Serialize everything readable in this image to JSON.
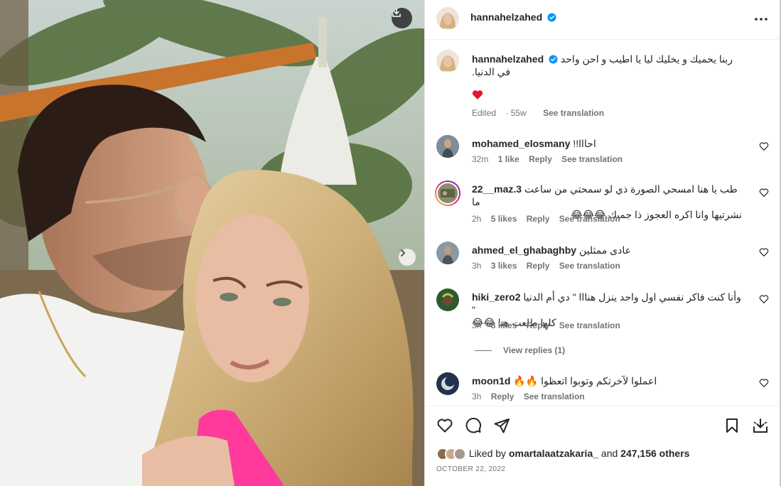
{
  "post": {
    "author": "hannahelzahed",
    "caption": "ربنا يحميك و يخليك ليا يا اطيب و احن واحد في الدنيا.",
    "caption_emoji": "❤️",
    "edited_label": "Edited",
    "age": "55w",
    "see_translation": "See translation"
  },
  "comments": [
    {
      "user": "mohamed_elosmany",
      "text": "احااا!!",
      "time": "32m",
      "likes": "1 like",
      "reply": "Reply",
      "translate": "See translation",
      "avatar_color": "#6d7f8e"
    },
    {
      "user": "22__maz.3",
      "text_line1": "طب يا هنا امسحي الصورة ذي لو سمحتي من ساعت ما",
      "text_line2": "نشرتيها وانا اكره العجوز ذا جمبك 😂😂😂",
      "time": "2h",
      "likes": "5 likes",
      "reply": "Reply",
      "translate": "See translation",
      "avatar_color": "#8a8f6a"
    },
    {
      "user": "ahmed_el_ghabaghby",
      "text": "عادى ممثلين",
      "time": "3h",
      "likes": "3 likes",
      "reply": "Reply",
      "translate": "See translation",
      "avatar_color": "#7a8a94"
    },
    {
      "user": "hiki_zero2",
      "text_line1": "وأنا كنت فاكر نفسي اول واحد ينزل هنااا \" دي أم الدنيا \"",
      "text_line2": "كلها طلعت هنا 😂😂",
      "time": "3h",
      "likes": "8 likes",
      "reply": "Reply",
      "translate": "See translation",
      "avatar_color": "#3e6a3a",
      "view_replies": "View replies (1)"
    },
    {
      "user": "moon1d",
      "text": "اعملوا لآخرتكم وتوبوا اتعظوا 🔥🔥",
      "time": "3h",
      "reply": "Reply",
      "translate": "See translation",
      "avatar_color": "#2f3b4f"
    }
  ],
  "footer": {
    "liked_by_prefix": "Liked by",
    "liked_by_user": "omartalaatzakaria_",
    "and": "and",
    "others": "247,156 others",
    "date": "OCTOBER 22, 2022"
  },
  "icons": {
    "like": "heart-outline-icon",
    "comment": "comment-bubble-icon",
    "share": "paper-plane-icon",
    "save": "bookmark-icon",
    "download": "download-icon",
    "more": "more-horizontal-icon",
    "next": "chevron-right-icon",
    "verified": "verified-badge-icon"
  },
  "colors": {
    "verified": "#0095f6",
    "heart_red": "#ff3040",
    "muted_text": "#737373",
    "text": "#262626"
  }
}
